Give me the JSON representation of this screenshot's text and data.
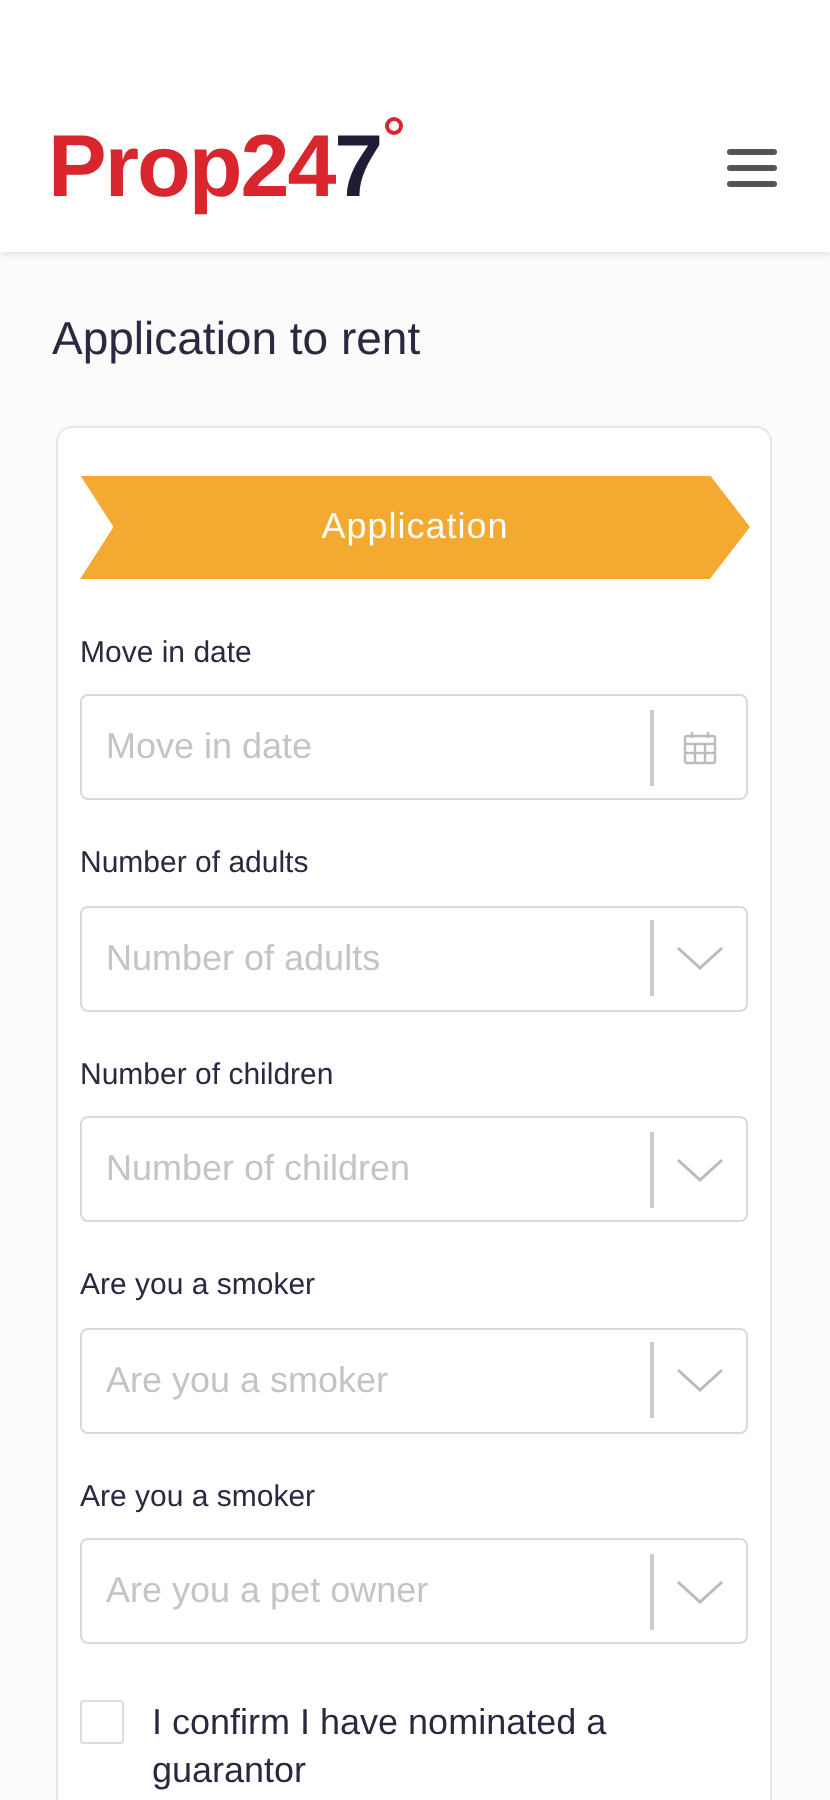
{
  "header": {
    "logo": [
      {
        "text": "Prop24",
        "color": "#d9262e"
      },
      {
        "text": "7",
        "color": "#201c36"
      }
    ]
  },
  "page_title": "Application to rent",
  "step_banner": "Application",
  "fields": [
    {
      "label": "Move in date",
      "placeholder": "Move in date",
      "kind": "date"
    },
    {
      "label": "Number of adults",
      "placeholder": "Number of adults",
      "kind": "select"
    },
    {
      "label": "Number of children",
      "placeholder": "Number of children",
      "kind": "select"
    },
    {
      "label": "Are you a smoker",
      "placeholder": "Are you a smoker",
      "kind": "select"
    },
    {
      "label": "Are you a smoker",
      "placeholder": "Are you a pet owner",
      "kind": "select"
    }
  ],
  "guarantor": {
    "label": "I confirm I have nominated a guarantor",
    "checked": false
  }
}
